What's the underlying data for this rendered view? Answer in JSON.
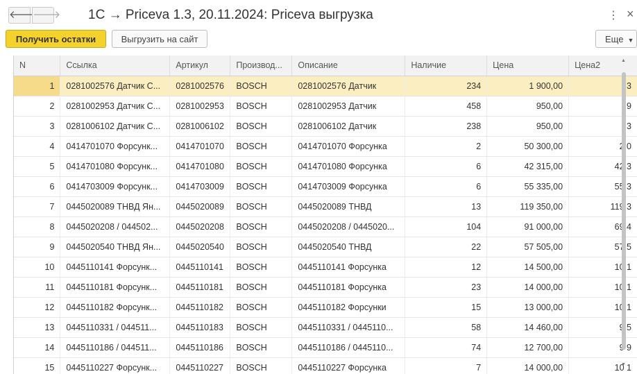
{
  "window": {
    "title": "1С → Priceva 1.3, 20.11.2024: Priceva выгрузка",
    "back_icon": "🡐",
    "forward_icon": "🡒",
    "menu_icon": "⋮",
    "close_icon": "×"
  },
  "toolbar": {
    "get_stock_label": "Получить остатки",
    "upload_label": "Выгрузить на сайт",
    "more_label": "Еще",
    "more_caret": "▼"
  },
  "colors": {
    "primary_button": "#f5d12d",
    "selected_row": "#fbefc2"
  },
  "table": {
    "columns": [
      "N",
      "Ссылка",
      "Артикул",
      "Производ...",
      "Описание",
      "Наличие",
      "Цена",
      "Цена2"
    ],
    "rows": [
      {
        "n": "1",
        "ref": "0281002576 Датчик С...",
        "article": "0281002576",
        "maker": "BOSCH",
        "desc": "0281002576 Датчик",
        "stock": "234",
        "price": "1 900,00",
        "price2": "3"
      },
      {
        "n": "2",
        "ref": "0281002953 Датчик С...",
        "article": "0281002953",
        "maker": "BOSCH",
        "desc": "0281002953 Датчик",
        "stock": "458",
        "price": "950,00",
        "price2": "9"
      },
      {
        "n": "3",
        "ref": "0281006102 Датчик С...",
        "article": "0281006102",
        "maker": "BOSCH",
        "desc": "0281006102 Датчик",
        "stock": "238",
        "price": "950,00",
        "price2": "3"
      },
      {
        "n": "4",
        "ref": "0414701070 Форсунк...",
        "article": "0414701070",
        "maker": "BOSCH",
        "desc": "0414701070 Форсунка",
        "stock": "2",
        "price": "50 300,00",
        "price2": "2 0"
      },
      {
        "n": "5",
        "ref": "0414701080 Форсунк...",
        "article": "0414701080",
        "maker": "BOSCH",
        "desc": "0414701080 Форсунка",
        "stock": "6",
        "price": "42 315,00",
        "price2": "42 3"
      },
      {
        "n": "6",
        "ref": "0414703009 Форсунк...",
        "article": "0414703009",
        "maker": "BOSCH",
        "desc": "0414703009 Форсунка",
        "stock": "6",
        "price": "55 335,00",
        "price2": "55 3"
      },
      {
        "n": "7",
        "ref": "0445020089 ТНВД Ян...",
        "article": "0445020089",
        "maker": "BOSCH",
        "desc": "0445020089 ТНВД",
        "stock": "13",
        "price": "119 350,00",
        "price2": "119 3"
      },
      {
        "n": "8",
        "ref": "0445020208 / 044502...",
        "article": "0445020208",
        "maker": "BOSCH",
        "desc": "0445020208 / 0445020...",
        "stock": "104",
        "price": "91 000,00",
        "price2": "69 4"
      },
      {
        "n": "9",
        "ref": "0445020540 ТНВД Ян...",
        "article": "0445020540",
        "maker": "BOSCH",
        "desc": "0445020540 ТНВД",
        "stock": "22",
        "price": "57 505,00",
        "price2": "57 5"
      },
      {
        "n": "10",
        "ref": "0445110141 Форсунк...",
        "article": "0445110141",
        "maker": "BOSCH",
        "desc": "0445110141 Форсунка",
        "stock": "12",
        "price": "14 500,00",
        "price2": "10 1"
      },
      {
        "n": "11",
        "ref": "0445110181 Форсунк...",
        "article": "0445110181",
        "maker": "BOSCH",
        "desc": "0445110181 Форсунка",
        "stock": "23",
        "price": "14 000,00",
        "price2": "10 1"
      },
      {
        "n": "12",
        "ref": "0445110182 Форсунк...",
        "article": "0445110182",
        "maker": "BOSCH",
        "desc": "0445110182 Форсунки",
        "stock": "15",
        "price": "13 000,00",
        "price2": "10 1"
      },
      {
        "n": "13",
        "ref": "0445110331 / 044511...",
        "article": "0445110183",
        "maker": "BOSCH",
        "desc": "0445110331 / 0445110...",
        "stock": "58",
        "price": "14 460,00",
        "price2": "9 5"
      },
      {
        "n": "14",
        "ref": "0445110186 / 044511...",
        "article": "0445110186",
        "maker": "BOSCH",
        "desc": "0445110186 / 0445110...",
        "stock": "74",
        "price": "12 700,00",
        "price2": "9 9"
      },
      {
        "n": "15",
        "ref": "0445110227 Форсунк...",
        "article": "0445110227",
        "maker": "BOSCH",
        "desc": "0445110227 Форсунка",
        "stock": "7",
        "price": "14 000,00",
        "price2": "10 1"
      }
    ]
  },
  "scrollbar": {
    "up_icon": "▲",
    "down_icon": "▼"
  }
}
